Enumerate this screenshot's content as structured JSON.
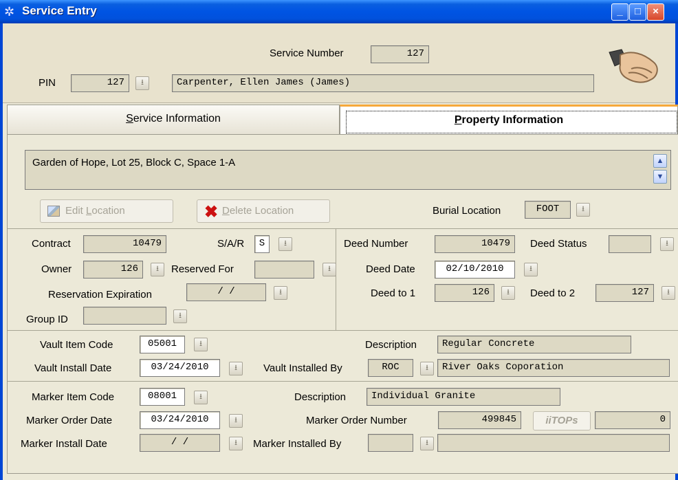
{
  "window": {
    "title": "Service Entry"
  },
  "header": {
    "service_number_label": "Service Number",
    "service_number": "127",
    "pin_label": "PIN",
    "pin": "127",
    "person_name": "Carpenter, Ellen James (James)"
  },
  "tabs": {
    "service": {
      "label_u": "S",
      "label_rest": "ervice Information"
    },
    "property": {
      "label_u": "P",
      "label_rest": "roperty Information"
    }
  },
  "location": {
    "text": "Garden of Hope, Lot 25, Block C, Space 1-A",
    "edit_button": {
      "pre": "Edit ",
      "u": "L",
      "post": "ocation"
    },
    "delete_button": {
      "u": "D",
      "post": "elete Location"
    },
    "burial_location_label": "Burial Location",
    "burial_location": "FOOT"
  },
  "contract": {
    "contract_label": "Contract",
    "contract": "10479",
    "sar_label": "S/A/R",
    "sar": "S",
    "owner_label": "Owner",
    "owner": "126",
    "reserved_for_label": "Reserved For",
    "reserved_for": "",
    "reservation_expiration_label": "Reservation Expiration",
    "reservation_expiration": "/ /",
    "group_id_label": "Group ID",
    "group_id": ""
  },
  "deed": {
    "deed_number_label": "Deed Number",
    "deed_number": "10479",
    "deed_status_label": "Deed Status",
    "deed_status": "",
    "deed_date_label": "Deed Date",
    "deed_date": "02/10/2010",
    "deed_to_1_label": "Deed to 1",
    "deed_to_1": "126",
    "deed_to_2_label": "Deed to 2",
    "deed_to_2": "127"
  },
  "vault": {
    "item_code_label": "Vault Item Code",
    "item_code": "05001",
    "description_label": "Description",
    "description": "Regular Concrete",
    "install_date_label": "Vault Install Date",
    "install_date": "03/24/2010",
    "installed_by_label": "Vault Installed By",
    "installed_by_code": "ROC",
    "installed_by_name": "River Oaks Coporation"
  },
  "marker": {
    "item_code_label": "Marker Item Code",
    "item_code": "08001",
    "description_label": "Description",
    "description": "Individual Granite",
    "order_date_label": "Marker Order Date",
    "order_date": "03/24/2010",
    "order_number_label": "Marker Order Number",
    "order_number": "499845",
    "itops_button": "iiTOPs",
    "itops_value": "0",
    "install_date_label": "Marker Install Date",
    "install_date": "/ /",
    "installed_by_label": "Marker Installed By",
    "installed_by_code": "",
    "installed_by_name": ""
  },
  "colors": {
    "titlebar": "#0054e3",
    "field_bg": "#ddd9c4",
    "tab_accent": "#f6a83a",
    "window_bg": "#ece9d8"
  }
}
